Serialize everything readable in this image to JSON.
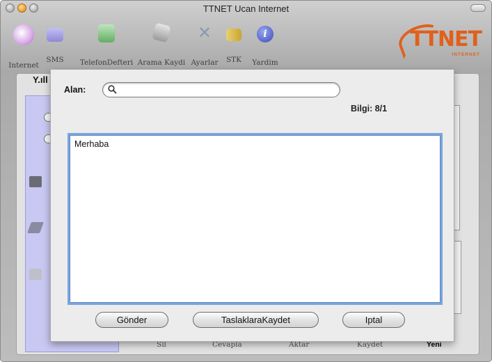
{
  "window": {
    "title": "TTNET Ucan Internet"
  },
  "toolbar": {
    "items": [
      {
        "label": "Internet",
        "icon": "globe-icon",
        "color": "#d9a8e8"
      },
      {
        "label": "SMS",
        "icon": "sms-icon",
        "color": "#8f88d8"
      },
      {
        "label": "TelefonDefteri",
        "icon": "phonebook-icon",
        "color": "#7ac27a"
      },
      {
        "label": "Arama Kaydi",
        "icon": "call-log-icon",
        "color": "#b0b0b0"
      },
      {
        "label": "Ayarlar",
        "icon": "settings-tools-icon",
        "color": "#c9c9c9"
      },
      {
        "label": "STK",
        "icon": "stk-icon",
        "color": "#e0c050"
      },
      {
        "label": "Yardim",
        "icon": "info-icon",
        "color": "#4a5bc8"
      }
    ]
  },
  "logo": {
    "text": "TTNET",
    "sub": "INTERNET",
    "color": "#e0601c"
  },
  "background": {
    "signal": "Y.ıll",
    "bottom_toolbar": [
      "Sil",
      "Cevapla",
      "Aktar",
      "Kaydet",
      "Yeni"
    ],
    "active_bottom": "Yeni"
  },
  "sheet": {
    "recipient_label": "Alan:",
    "recipient_value": "",
    "info": "Bilgi: 8/1",
    "message": "Merhaba",
    "buttons": {
      "send": "Gönder",
      "save_draft": "TaslaklaraKaydet",
      "cancel": "Iptal"
    }
  }
}
